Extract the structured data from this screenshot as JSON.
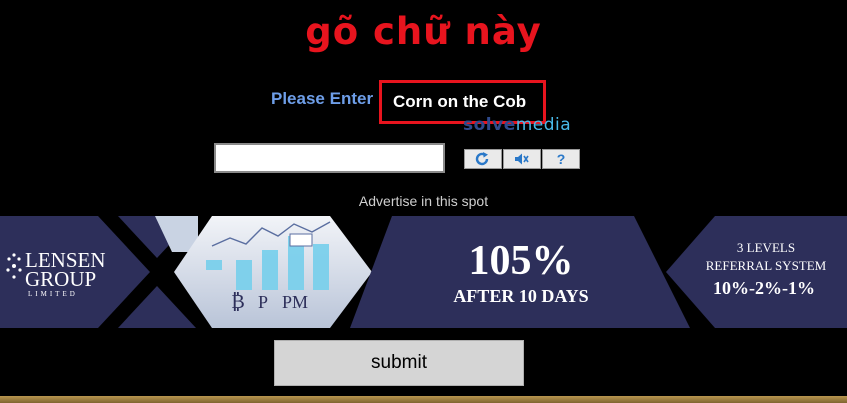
{
  "annotation": "gõ chữ này",
  "captcha": {
    "prompt_label": "Please Enter",
    "phrase": "Corn on the Cob",
    "brand_part1": "solve",
    "brand_part2": "media",
    "input_value": "",
    "refresh_icon": "refresh-icon",
    "audio_icon": "speaker-icon",
    "help_icon": "help-icon",
    "help_label": "?"
  },
  "ad": {
    "label": "Advertise in this spot",
    "logo_line1": "LENSEN",
    "logo_line2": "GROUP",
    "logo_line3": "LIMITED",
    "ticker_pm": "PM",
    "ticker_p": "P",
    "percent": "105%",
    "after_days": "AFTER 10 DAYS",
    "levels": "3 LEVELS",
    "referral": "REFERRAL SYSTEM",
    "referral_rates": "10%-2%-1%"
  },
  "form": {
    "submit_label": "submit"
  },
  "colors": {
    "annotation": "#e8141e",
    "prompt": "#6e9ee8",
    "banner_navy": "#2d2f5a",
    "footer_gold": "#b8954f"
  }
}
